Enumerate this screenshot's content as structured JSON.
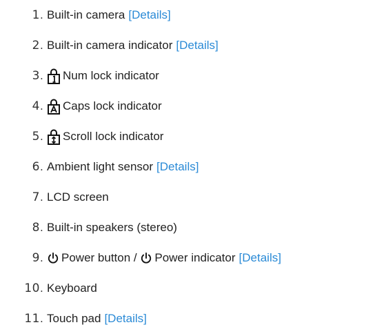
{
  "items": [
    {
      "number": "1",
      "label": "Built-in camera",
      "link": "[Details]"
    },
    {
      "number": "2",
      "label": "Built-in camera indicator",
      "link": "[Details]"
    },
    {
      "number": "3",
      "label": "Num lock indicator",
      "icon": "num-lock-icon"
    },
    {
      "number": "4",
      "label": "Caps lock indicator",
      "icon": "caps-lock-icon"
    },
    {
      "number": "5",
      "label": "Scroll lock indicator",
      "icon": "scroll-lock-icon"
    },
    {
      "number": "6",
      "label": "Ambient light sensor",
      "link": "[Details]"
    },
    {
      "number": "7",
      "label": "LCD screen"
    },
    {
      "number": "8",
      "label": "Built-in speakers (stereo)"
    },
    {
      "number": "9",
      "label": "Power button",
      "label2": "Power indicator",
      "separator": " / ",
      "icon": "power-icon",
      "link": "[Details]"
    },
    {
      "number": "10",
      "label": "Keyboard"
    },
    {
      "number": "11",
      "label": "Touch pad",
      "link": "[Details]"
    }
  ],
  "colors": {
    "link": "#2a8ad6",
    "text": "#222222"
  }
}
